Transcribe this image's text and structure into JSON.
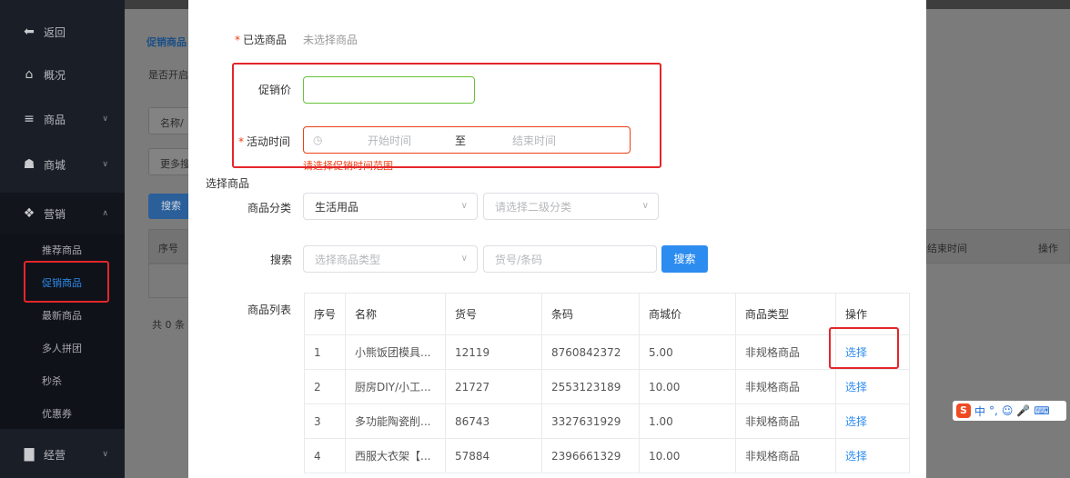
{
  "sidebar": {
    "back": "返回",
    "items": [
      {
        "label": "概况",
        "icon": "home-icon"
      },
      {
        "label": "商品",
        "icon": "menu-icon"
      },
      {
        "label": "商城",
        "icon": "shop-icon"
      },
      {
        "label": "营销",
        "icon": "gift-icon"
      },
      {
        "label": "经营",
        "icon": "chart-icon"
      }
    ],
    "submenu": [
      "推荐商品",
      "促销商品",
      "最新商品",
      "多人拼团",
      "秒杀",
      "优惠券"
    ],
    "active_sub": "促销商品"
  },
  "background_page": {
    "section_title": "促销商品",
    "enable_label": "是否开启",
    "search_placeholder": "名称/",
    "more_button": "更多搜",
    "search_button": "搜索",
    "col_index": "序号",
    "col_end_time": "结束时间",
    "col_action": "操作",
    "total": "共 0 条"
  },
  "modal": {
    "selected_label": "已选商品",
    "selected_value": "未选择商品",
    "price_label": "促销价",
    "price_value": "",
    "time_label": "活动时间",
    "start_placeholder": "开始时间",
    "range_sep": "至",
    "end_placeholder": "结束时间",
    "time_error": "请选择促销时间范围",
    "section_select": "选择商品",
    "category_label": "商品分类",
    "category_value": "生活用品",
    "subcategory_placeholder": "请选择二级分类",
    "search_label": "搜索",
    "type_placeholder": "选择商品类型",
    "code_placeholder": "货号/条码",
    "search_button": "搜索",
    "list_label": "商品列表",
    "table": {
      "headers": [
        "序号",
        "名称",
        "货号",
        "条码",
        "商城价",
        "商品类型",
        "操作"
      ],
      "rows": [
        [
          "1",
          "小熊饭团模具...",
          "12119",
          "8760842372",
          "5.00",
          "非规格商品",
          "选择"
        ],
        [
          "2",
          "厨房DIY/小工...",
          "21727",
          "2553123189",
          "10.00",
          "非规格商品",
          "选择"
        ],
        [
          "3",
          "多功能陶瓷削...",
          "86743",
          "3327631929",
          "1.00",
          "非规格商品",
          "选择"
        ],
        [
          "4",
          "西服大衣架【...",
          "57884",
          "2396661329",
          "10.00",
          "非规格商品",
          "选择"
        ]
      ]
    }
  },
  "ime": {
    "lang": "中",
    "punct": "°,"
  },
  "colors": {
    "primary": "#2d8cf0",
    "error": "#ed4014",
    "highlight": "#e4262b",
    "sidebar": "#1a1e27"
  }
}
